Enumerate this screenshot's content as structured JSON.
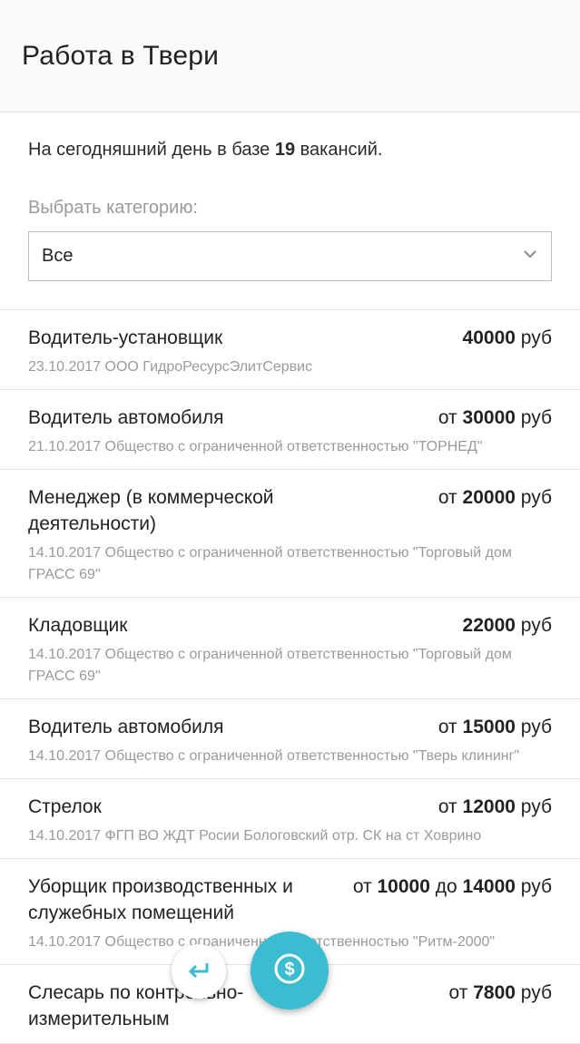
{
  "header": {
    "title": "Работа в Твери"
  },
  "intro": {
    "prefix": "На сегодняшний день в базе",
    "count": "19",
    "suffix": "вакансий."
  },
  "category": {
    "label": "Выбрать категорию:",
    "selected": "Все"
  },
  "jobs": [
    {
      "title": "Водитель-установщик",
      "salary_prefix": "",
      "salary_from": "40000",
      "salary_mid": "",
      "salary_to": "",
      "currency": "руб",
      "meta": "23.10.2017 ООО ГидроРесурсЭлитСервис"
    },
    {
      "title": "Водитель автомобиля",
      "salary_prefix": "от",
      "salary_from": "30000",
      "salary_mid": "",
      "salary_to": "",
      "currency": "руб",
      "meta": "21.10.2017 Общество с ограниченной ответственностью \"ТОРНЕД\""
    },
    {
      "title": "Менеджер (в коммерческой деятельности)",
      "salary_prefix": "от",
      "salary_from": "20000",
      "salary_mid": "",
      "salary_to": "",
      "currency": "руб",
      "meta": "14.10.2017 Общество с ограниченной ответственностью \"Торговый дом ГРАСС 69\""
    },
    {
      "title": "Кладовщик",
      "salary_prefix": "",
      "salary_from": "22000",
      "salary_mid": "",
      "salary_to": "",
      "currency": "руб",
      "meta": "14.10.2017 Общество с ограниченной ответственностью \"Торговый дом ГРАСС 69\""
    },
    {
      "title": "Водитель автомобиля",
      "salary_prefix": "от",
      "salary_from": "15000",
      "salary_mid": "",
      "salary_to": "",
      "currency": "руб",
      "meta": "14.10.2017 Общество с ограниченной ответственностью \"Тверь клининг\""
    },
    {
      "title": "Стрелок",
      "salary_prefix": "от",
      "salary_from": "12000",
      "salary_mid": "",
      "salary_to": "",
      "currency": "руб",
      "meta": "14.10.2017 ФГП ВО ЖДТ Росии Бологовский отр. СК на ст Ховрино"
    },
    {
      "title": "Уборщик производственных и служебных помещений",
      "salary_prefix": "от",
      "salary_from": "10000",
      "salary_mid": "до",
      "salary_to": "14000",
      "currency": "руб",
      "meta": "14.10.2017 Общество с ограниченной ответственностью \"Ритм-2000\""
    },
    {
      "title": "Слесарь по контрольно-измерительным",
      "salary_prefix": "от",
      "salary_from": "7800",
      "salary_mid": "",
      "salary_to": "",
      "currency": "руб",
      "meta": ""
    }
  ],
  "icons": {
    "dropdown": "chevron-down-icon",
    "back": "reply-arrow-icon",
    "salary": "dollar-icon"
  },
  "colors": {
    "accent": "#3bbcd0",
    "meta_text": "#9a9a9a"
  }
}
